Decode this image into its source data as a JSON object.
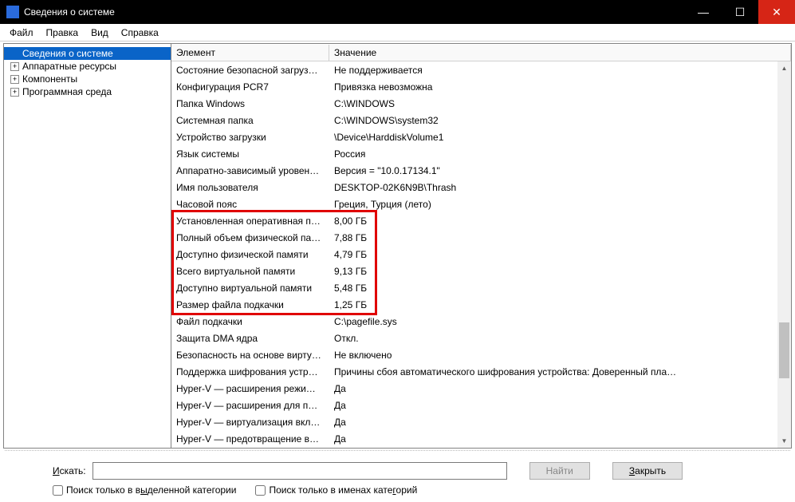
{
  "window": {
    "title": "Сведения о системе"
  },
  "menu": {
    "file": "Файл",
    "edit": "Правка",
    "view": "Вид",
    "help": "Справка"
  },
  "tree": {
    "items": [
      {
        "label": "Сведения о системе",
        "selected": true,
        "expandable": false
      },
      {
        "label": "Аппаратные ресурсы",
        "selected": false,
        "expandable": true
      },
      {
        "label": "Компоненты",
        "selected": false,
        "expandable": true
      },
      {
        "label": "Программная среда",
        "selected": false,
        "expandable": true
      }
    ]
  },
  "columns": {
    "c0": "Элемент",
    "c1": "Значение"
  },
  "rows": [
    {
      "k": "Состояние безопасной загруз…",
      "v": "Не поддерживается"
    },
    {
      "k": "Конфигурация PCR7",
      "v": "Привязка невозможна"
    },
    {
      "k": "Папка Windows",
      "v": "C:\\WINDOWS"
    },
    {
      "k": "Системная папка",
      "v": "C:\\WINDOWS\\system32"
    },
    {
      "k": "Устройство загрузки",
      "v": "\\Device\\HarddiskVolume1"
    },
    {
      "k": "Язык системы",
      "v": "Россия"
    },
    {
      "k": "Аппаратно-зависимый уровен…",
      "v": "Версия = \"10.0.17134.1\""
    },
    {
      "k": "Имя пользователя",
      "v": "DESKTOP-02K6N9B\\Thrash"
    },
    {
      "k": "Часовой пояс",
      "v": "Греция, Турция (лето)"
    },
    {
      "k": "Установленная оперативная п…",
      "v": "8,00 ГБ"
    },
    {
      "k": "Полный объем физической па…",
      "v": "7,88 ГБ"
    },
    {
      "k": "Доступно физической памяти",
      "v": "4,79 ГБ"
    },
    {
      "k": "Всего виртуальной памяти",
      "v": "9,13 ГБ"
    },
    {
      "k": "Доступно виртуальной памяти",
      "v": "5,48 ГБ"
    },
    {
      "k": "Размер файла подкачки",
      "v": "1,25 ГБ"
    },
    {
      "k": "Файл подкачки",
      "v": "C:\\pagefile.sys"
    },
    {
      "k": "Защита DMA ядра",
      "v": "Откл."
    },
    {
      "k": "Безопасность на основе вирту…",
      "v": "Не включено"
    },
    {
      "k": "Поддержка шифрования устр…",
      "v": "Причины сбоя автоматического шифрования устройства: Доверенный пла…"
    },
    {
      "k": "Hyper-V — расширения режи…",
      "v": "Да"
    },
    {
      "k": "Hyper-V — расширения для п…",
      "v": "Да"
    },
    {
      "k": "Hyper-V — виртуализация вкл…",
      "v": "Да"
    },
    {
      "k": "Hyper-V — предотвращение в…",
      "v": "Да"
    }
  ],
  "search": {
    "label_prefix": "И",
    "label_rest": "скать:",
    "find": "Найти",
    "close_prefix": "З",
    "close_rest": "акрыть",
    "chk1_a": "Поиск только в в",
    "chk1_b": "ы",
    "chk1_c": "деленной категории",
    "chk2_a": "Поиск только в именах кате",
    "chk2_b": "г",
    "chk2_c": "орий"
  },
  "winbtns": {
    "min": "—",
    "max": "☐",
    "close": "✕"
  }
}
